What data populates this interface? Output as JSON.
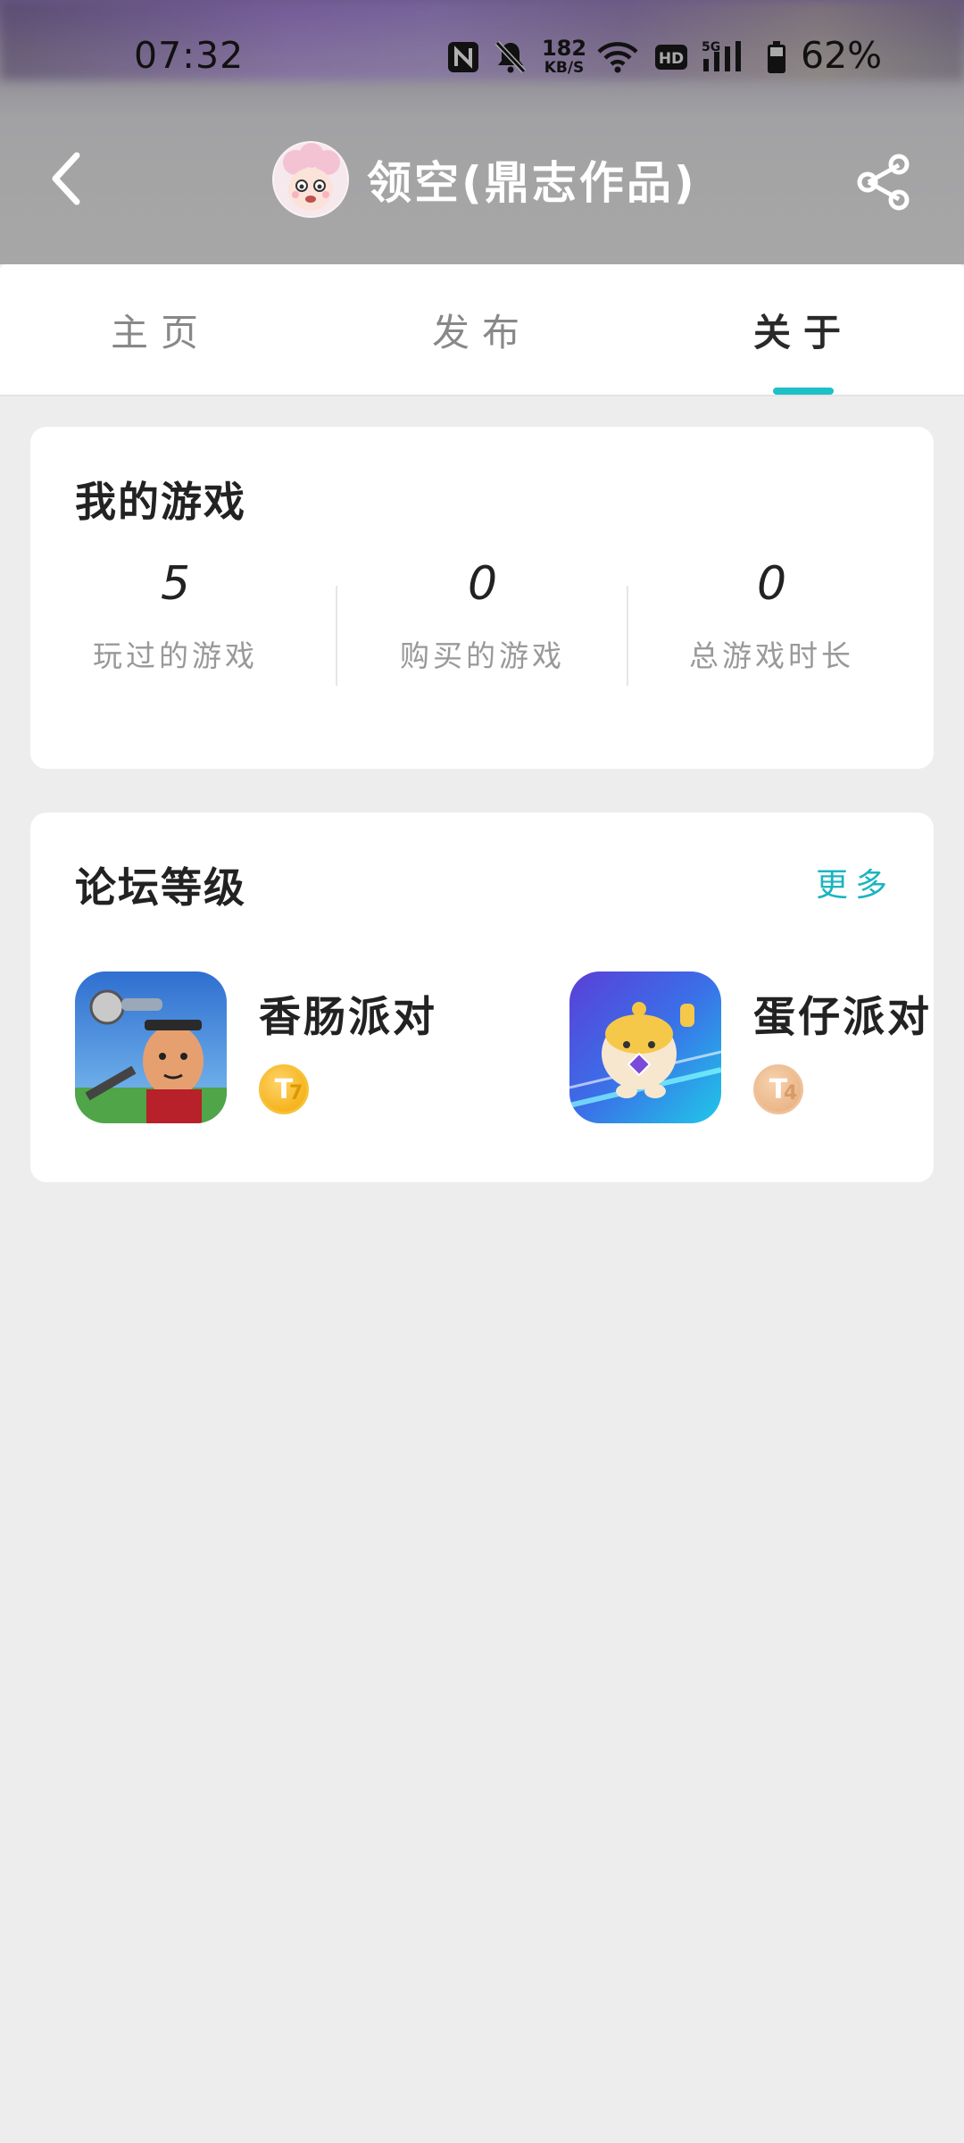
{
  "status_bar": {
    "time": "07:32",
    "speed_value": "182",
    "speed_unit": "KB/S",
    "battery": "62%"
  },
  "header": {
    "title": "领空(鼎志作品)",
    "icons": [
      "back-arrow-icon",
      "avatar",
      "share-icon"
    ]
  },
  "tabs": [
    {
      "label": "主页",
      "active": false
    },
    {
      "label": "发布",
      "active": false
    },
    {
      "label": "关于",
      "active": true
    }
  ],
  "accent_color": "#1ec0c8",
  "my_games": {
    "title": "我的游戏",
    "stats": [
      {
        "value": "5",
        "label": "玩过的游戏"
      },
      {
        "value": "0",
        "label": "购买的游戏"
      },
      {
        "value": "0",
        "label": "总游戏时长"
      }
    ]
  },
  "forum_level": {
    "title": "论坛等级",
    "more_label": "更多",
    "games": [
      {
        "name": "香肠派对",
        "level_badge": "T",
        "level": "7"
      },
      {
        "name": "蛋仔派对",
        "level_badge": "T",
        "level": "4"
      }
    ]
  }
}
